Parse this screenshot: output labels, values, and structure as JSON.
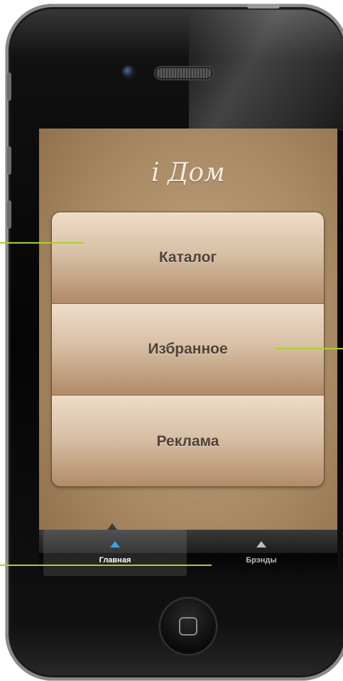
{
  "app": {
    "title": "i Дом"
  },
  "menu": {
    "items": [
      {
        "label": "Каталог"
      },
      {
        "label": "Избранное"
      },
      {
        "label": "Реклама"
      }
    ]
  },
  "tabbar": {
    "tabs": [
      {
        "label": "Главная",
        "icon": "triangle-up-icon",
        "active": true
      },
      {
        "label": "Брэнды",
        "icon": "triangle-up-icon",
        "active": false
      }
    ]
  },
  "colors": {
    "accent": "#36a3ea",
    "screen_bg": "#a98a64",
    "callout": "#a8d224",
    "button_text": "#4f4238"
  }
}
